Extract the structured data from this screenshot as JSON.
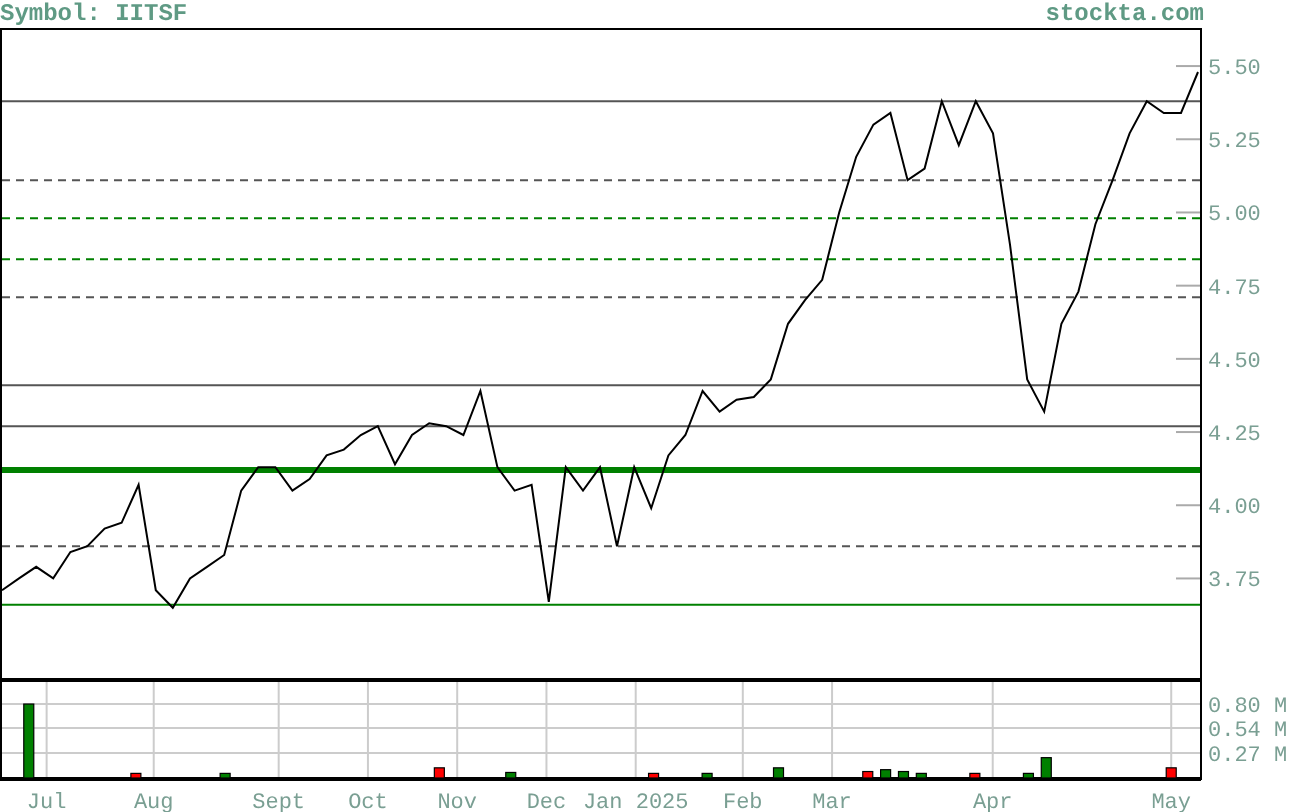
{
  "header": {
    "symbol": "Symbol: IITSF",
    "source": "stockta.com"
  },
  "price_chart": {
    "chart_data": {
      "type": "line",
      "series": [
        {
          "color": "#000000",
          "values": [
            3.71,
            3.75,
            3.79,
            3.75,
            3.84,
            3.86,
            3.92,
            3.94,
            4.07,
            3.71,
            3.65,
            3.75,
            3.79,
            3.83,
            4.05,
            4.13,
            4.13,
            4.05,
            4.09,
            4.17,
            4.19,
            4.24,
            4.27,
            4.14,
            4.24,
            4.28,
            4.27,
            4.24,
            4.39,
            4.13,
            4.05,
            4.07,
            3.67,
            4.13,
            4.05,
            4.13,
            3.86,
            4.13,
            3.99,
            4.17,
            4.24,
            4.39,
            4.32,
            4.36,
            4.37,
            4.43,
            4.62,
            4.7,
            4.77,
            5.0,
            5.19,
            5.3,
            5.34,
            5.11,
            5.15,
            5.38,
            5.23,
            5.38,
            5.27,
            4.89,
            4.43,
            4.32,
            4.62,
            4.73,
            4.96,
            5.11,
            5.27,
            5.38,
            5.34,
            5.34,
            5.48
          ]
        }
      ],
      "ylim": [
        3.41,
        5.63
      ],
      "yticks": [
        {
          "value": 3.75,
          "label": "3.75"
        },
        {
          "value": 4.0,
          "label": "4.00"
        },
        {
          "value": 4.25,
          "label": "4.25"
        },
        {
          "value": 4.5,
          "label": "4.50"
        },
        {
          "value": 4.75,
          "label": "4.75"
        },
        {
          "value": 5.0,
          "label": "5.00"
        },
        {
          "value": 5.25,
          "label": "5.25"
        },
        {
          "value": 5.5,
          "label": "5.50"
        }
      ],
      "ref_lines": [
        {
          "axis": "y",
          "value": 5.38,
          "color": "#555555"
        },
        {
          "axis": "y",
          "value": 5.11,
          "color": "#555555"
        },
        {
          "axis": "y",
          "value": 4.98,
          "color": "#008000"
        },
        {
          "axis": "y",
          "value": 4.84,
          "color": "#008000"
        },
        {
          "axis": "y",
          "value": 4.71,
          "color": "#555555"
        },
        {
          "axis": "y",
          "value": 4.41,
          "color": "#555555"
        },
        {
          "axis": "y",
          "value": 4.27,
          "color": "#555555"
        },
        {
          "axis": "y",
          "value": 4.12,
          "color": "#008000"
        },
        {
          "axis": "y",
          "value": 3.86,
          "color": "#555555"
        },
        {
          "axis": "y",
          "value": 3.66,
          "color": "#008000"
        }
      ]
    }
  },
  "volume_chart": {
    "chart_data": {
      "type": "bar",
      "categories": [
        null,
        null,
        "Jul",
        null,
        null,
        null,
        null,
        null,
        "Aug",
        null,
        null,
        null,
        null,
        null,
        null,
        "Sept",
        null,
        null,
        null,
        null,
        "Oct",
        null,
        null,
        null,
        null,
        "Nov",
        null,
        null,
        null,
        null,
        "Dec",
        null,
        null,
        null,
        null,
        "Jan 2025",
        null,
        null,
        null,
        null,
        null,
        "Feb",
        null,
        null,
        null,
        null,
        "Mar",
        null,
        null,
        null,
        null,
        null,
        null,
        null,
        null,
        "Apr",
        null,
        null,
        null,
        null,
        null,
        null,
        null,
        null,
        null,
        "May",
        null
      ],
      "series": [
        {
          "color": "#008000",
          "values": [
            null,
            0.8,
            null,
            null,
            null,
            null,
            null,
            null,
            null,
            null,
            null,
            null,
            0.05,
            null,
            null,
            null,
            null,
            null,
            null,
            null,
            null,
            null,
            null,
            null,
            null,
            null,
            null,
            null,
            0.06,
            null,
            null,
            null,
            null,
            null,
            null,
            null,
            null,
            null,
            null,
            0.05,
            null,
            null,
            null,
            0.11,
            null,
            null,
            null,
            null,
            null,
            0.09,
            0.07,
            0.05,
            null,
            null,
            null,
            null,
            null,
            0.05,
            0.22,
            null,
            null,
            null,
            null,
            null,
            null,
            null,
            null
          ]
        },
        {
          "color": "#ff0000",
          "values": [
            null,
            null,
            null,
            null,
            null,
            null,
            null,
            0.05,
            null,
            null,
            null,
            null,
            null,
            null,
            null,
            null,
            null,
            null,
            null,
            null,
            null,
            null,
            null,
            null,
            0.11,
            null,
            null,
            null,
            null,
            null,
            null,
            null,
            null,
            null,
            null,
            null,
            0.05,
            null,
            null,
            null,
            null,
            null,
            null,
            null,
            null,
            null,
            null,
            null,
            0.07,
            null,
            null,
            null,
            null,
            null,
            0.05,
            null,
            null,
            null,
            null,
            null,
            null,
            null,
            null,
            null,
            null,
            0.11,
            null
          ]
        }
      ],
      "ylim": [
        0,
        1.06
      ],
      "grid": true,
      "yticks": [
        {
          "value": 0.27,
          "label": "0.27 M"
        },
        {
          "value": 0.54,
          "label": "0.54 M"
        },
        {
          "value": 0.8,
          "label": "0.80 M"
        }
      ]
    }
  }
}
